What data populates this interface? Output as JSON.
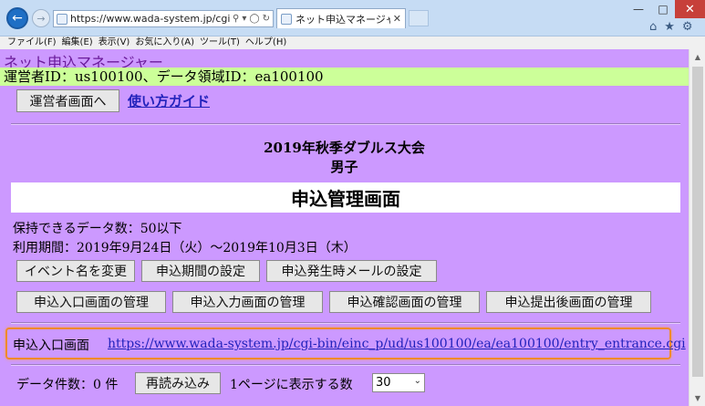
{
  "browser": {
    "url": "https://www.wada-system.jp/cgi-bin/einc_",
    "tab_title": "ネット申込マネージャー 申込...",
    "menu": [
      "ファイル(F)",
      "編集(E)",
      "表示(V)",
      "お気に入り(A)",
      "ツール(T)",
      "ヘルプ(H)"
    ]
  },
  "page": {
    "app_title": "ネット申込マネージャー",
    "operator_info": "運営者ID：us100100、データ領域ID：ea100100",
    "operator_button": "運営者画面へ",
    "guide_link": "使い方ガイド",
    "event_name": "2019年秋季ダブルス大会",
    "event_category": "男子",
    "screen_title": "申込管理画面",
    "data_capacity": "保持できるデータ数：50以下",
    "usage_period": "利用期間：2019年9月24日（火）〜2019年10月3日（木）",
    "buttons_row1": [
      "イベント名を変更",
      "申込期間の設定",
      "申込発生時メールの設定"
    ],
    "buttons_row2": [
      "申込入口画面の管理",
      "申込入力画面の管理",
      "申込確認画面の管理",
      "申込提出後画面の管理"
    ],
    "entrance_label": "申込入口画面",
    "entrance_url": "https://www.wada-system.jp/cgi-bin/einc_p/ud/us100100/ea/ea100100/entry_entrance.cgi",
    "data_count": "データ件数：0 件",
    "reload_button": "再読み込み",
    "per_page_label": "1ページに表示する数",
    "per_page_value": "30"
  }
}
